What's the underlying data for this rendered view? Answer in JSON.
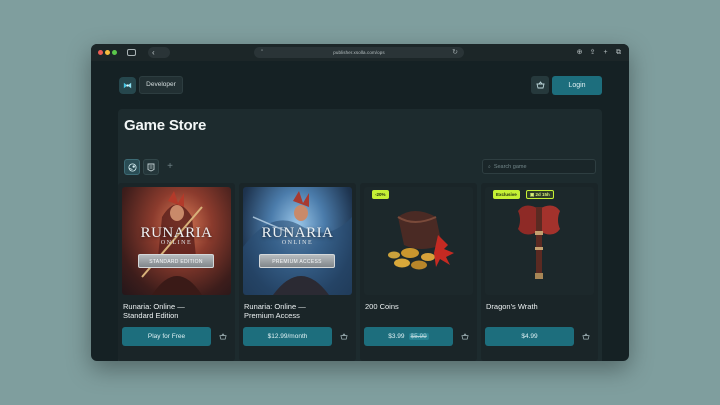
{
  "browser": {
    "url": "publisher.xsolla.com/ops"
  },
  "header": {
    "developer_label": "Developer",
    "login_label": "Login"
  },
  "store": {
    "title": "Game Store",
    "search_placeholder": "Search game"
  },
  "products": [
    {
      "art_title": "RUNARIA",
      "art_subtitle": "ONLINE",
      "art_edition": "STANDARD EDITION",
      "name_line1": "Runaria: Online —",
      "name_line2": "Standard Edition",
      "button_label": "Play for Free"
    },
    {
      "art_title": "RUNARIA",
      "art_subtitle": "ONLINE",
      "art_edition": "PREMIUM ACCESS",
      "name_line1": "Runaria: Online —",
      "name_line2": "Premium Access",
      "button_label": "$12.99/month"
    },
    {
      "badge": "-20%",
      "name_line1": "200 Coins",
      "price": "$3.99",
      "old_price": "$5.99"
    },
    {
      "badge_exclusive": "Exclusive",
      "badge_timer": "2d 15h",
      "name_line1": "Dragon's Wrath",
      "button_label": "$4.99"
    }
  ],
  "colors": {
    "accent": "#1d6e7d",
    "badge": "#c6f135",
    "background": "#7f9e9e"
  }
}
